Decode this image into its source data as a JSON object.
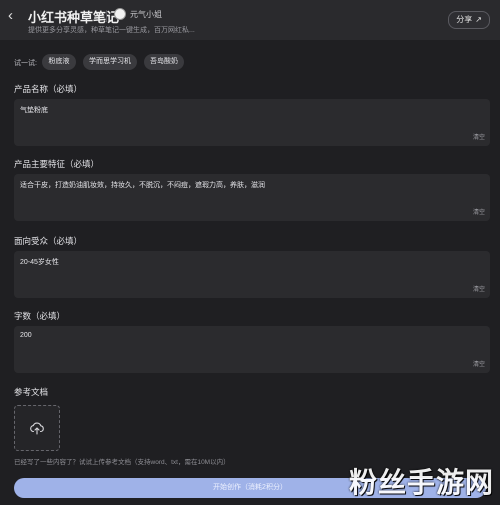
{
  "header": {
    "title": "小红书种草笔记",
    "owner": "元气小姐",
    "subtitle": "提供更多分享灵感，种草笔记一键生成，百万网红私...",
    "share_label": "分享"
  },
  "try": {
    "label": "试一试:",
    "chips": [
      "粉底液",
      "学而思学习机",
      "吾岛酸奶"
    ]
  },
  "fields": [
    {
      "label": "产品名称（必填）",
      "value": "气垫粉底",
      "clear": "清空"
    },
    {
      "label": "产品主要特征（必填）",
      "value": "适合干皮，打造奶油肌妆效，持妆久，不脱沉，不闷痘，遮瑕力高，养肤，滋润",
      "clear": "清空"
    },
    {
      "label": "面向受众（必填）",
      "value": "20-45岁女性",
      "clear": "清空"
    },
    {
      "label": "字数（必填）",
      "value": "200",
      "clear": "清空"
    }
  ],
  "reference": {
    "label": "参考文档",
    "hint": "已经写了一些内容了？试试上传参考文档（支持word、txt，需在10M以内）"
  },
  "start_button": "开始创作（消耗2积分）",
  "watermark": "粉丝手游网",
  "colors": {
    "accent_button": "#9fb2e8",
    "background": "#1f1f22",
    "field": "#2b2b2e"
  }
}
